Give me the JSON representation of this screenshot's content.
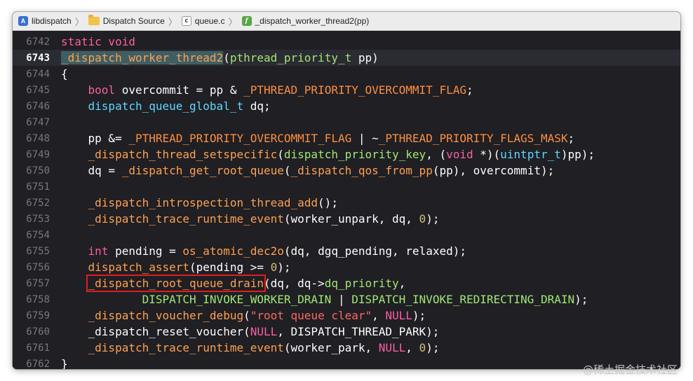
{
  "breadcrumb": {
    "project": "libdispatch",
    "folder": "Dispatch Source",
    "file": "queue.c",
    "symbol": "_dispatch_worker_thread2(pp)",
    "icons": {
      "project": "A",
      "file": "c",
      "symbol": "f"
    }
  },
  "editor": {
    "current_line": "6743",
    "lines": [
      {
        "n": "6742",
        "t": [
          "static void"
        ]
      },
      {
        "n": "6743",
        "t": [
          "_dispatch_worker_thread2",
          "(",
          "pthread_priority_t",
          " pp)"
        ]
      },
      {
        "n": "6744",
        "t": [
          "{"
        ]
      },
      {
        "n": "6745",
        "t": [
          "    ",
          "bool",
          " overcommit = pp & ",
          "_PTHREAD_PRIORITY_OVERCOMMIT_FLAG",
          ";"
        ]
      },
      {
        "n": "6746",
        "t": [
          "    ",
          "dispatch_queue_global_t",
          " dq;"
        ]
      },
      {
        "n": "6747",
        "t": [
          ""
        ]
      },
      {
        "n": "6748",
        "t": [
          "    pp &= ",
          "_PTHREAD_PRIORITY_OVERCOMMIT_FLAG",
          " | ~",
          "_PTHREAD_PRIORITY_FLAGS_MASK",
          ";"
        ]
      },
      {
        "n": "6749",
        "t": [
          "    ",
          "_dispatch_thread_setspecific",
          "(",
          "dispatch_priority_key",
          ", (",
          "void",
          " *)(",
          "uintptr_t",
          ")pp);"
        ]
      },
      {
        "n": "6750",
        "t": [
          "    dq = ",
          "_dispatch_get_root_queue",
          "(",
          "_dispatch_qos_from_pp",
          "(pp), overcommit);"
        ]
      },
      {
        "n": "6751",
        "t": [
          ""
        ]
      },
      {
        "n": "6752",
        "t": [
          "    ",
          "_dispatch_introspection_thread_add",
          "();"
        ]
      },
      {
        "n": "6753",
        "t": [
          "    ",
          "_dispatch_trace_runtime_event",
          "(worker_unpark, dq, ",
          "0",
          ");"
        ]
      },
      {
        "n": "6754",
        "t": [
          ""
        ]
      },
      {
        "n": "6755",
        "t": [
          "    ",
          "int",
          " pending = ",
          "os_atomic_dec2o",
          "(dq, dgq_pending, relaxed);"
        ]
      },
      {
        "n": "6756",
        "t": [
          "    ",
          "dispatch_assert",
          "(pending >= ",
          "0",
          ");"
        ]
      },
      {
        "n": "6757",
        "t": [
          "    ",
          "_dispatch_root_queue_drain",
          "(dq, dq->",
          "dq_priority",
          ","
        ]
      },
      {
        "n": "6758",
        "t": [
          "            ",
          "DISPATCH_INVOKE_WORKER_DRAIN",
          " | ",
          "DISPATCH_INVOKE_REDIRECTING_DRAIN",
          ");"
        ]
      },
      {
        "n": "6759",
        "t": [
          "    ",
          "_dispatch_voucher_debug",
          "(",
          "\"root queue clear\"",
          ", ",
          "NULL",
          ");"
        ]
      },
      {
        "n": "6760",
        "t": [
          "    _dispatch_reset_voucher(",
          "NULL",
          ", DISPATCH_THREAD_PARK);"
        ]
      },
      {
        "n": "6761",
        "t": [
          "    ",
          "_dispatch_trace_runtime_event",
          "(worker_park, ",
          "NULL",
          ", ",
          "0",
          ");"
        ]
      },
      {
        "n": "6762",
        "t": [
          "}"
        ]
      }
    ]
  },
  "watermark": "@稀土掘金技术社区",
  "colors": {
    "background": "#1f1f24",
    "keyword": "#fc5fa3",
    "function": "#ffa14f",
    "type": "#5dd8ff",
    "constant": "#78c2b3",
    "number": "#d0bf69",
    "string": "#fc6a5d",
    "highlight_box": "#e11d1d"
  }
}
